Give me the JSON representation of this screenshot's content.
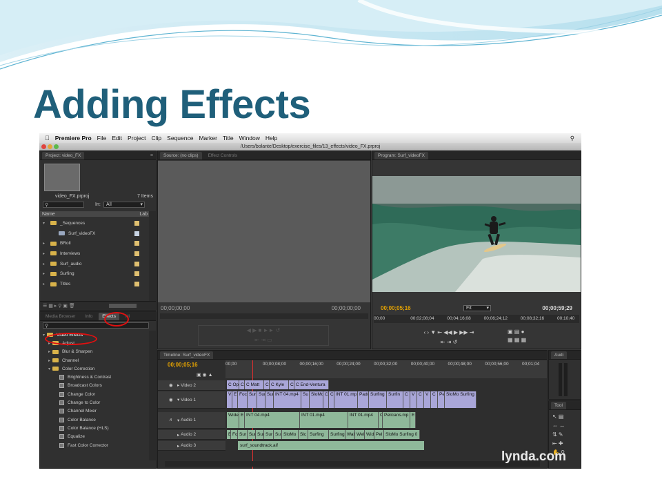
{
  "slide": {
    "title": "Adding Effects"
  },
  "menubar": {
    "apple": "",
    "app": "Premiere Pro",
    "items": [
      "File",
      "Edit",
      "Project",
      "Clip",
      "Sequence",
      "Marker",
      "Title",
      "Window",
      "Help"
    ]
  },
  "window": {
    "path": "/Users/bolante/Desktop/exercise_files/13_effects/video_FX.prproj"
  },
  "project": {
    "tab": "Project: video_FX",
    "filename": "video_FX.prproj",
    "item_count": "7 Items",
    "in_label": "In:",
    "in_value": "All",
    "col_name": "Name",
    "col_label": "Lab",
    "items": [
      {
        "name": "_Sequences",
        "indent": 0,
        "open": true
      },
      {
        "name": "Surf_videoFX",
        "indent": 1,
        "open": false
      },
      {
        "name": "BRoll",
        "indent": 0,
        "open": false
      },
      {
        "name": "Interviews",
        "indent": 0,
        "open": false
      },
      {
        "name": "Surf_audio",
        "indent": 0,
        "open": false
      },
      {
        "name": "Surfing",
        "indent": 0,
        "open": false
      },
      {
        "name": "Titles",
        "indent": 0,
        "open": false
      }
    ]
  },
  "lowerleft": {
    "tabs": [
      "Media Browser",
      "Info",
      "Effects",
      "Hi"
    ],
    "active": "Effects",
    "effects_root": "Video Effects",
    "folders": [
      "Adjust",
      "Blur & Sharpen",
      "Channel",
      "Color Correction"
    ],
    "effects": [
      "Brightness & Contrast",
      "Broadcast Colors",
      "Change Color",
      "Change to Color",
      "Channel Mixer",
      "Color Balance",
      "Color Balance (HLS)",
      "Equalize",
      "Fast Color Corrector"
    ]
  },
  "source": {
    "tabs": [
      "Source: (no clips)",
      "Effect Controls"
    ],
    "tc_left": "00;00;00;00",
    "tc_right": "00;00;00;00"
  },
  "program": {
    "tab": "Program: Surf_videoFX",
    "tc_current": "00;00;05;16",
    "fit": "Fit",
    "tc_duration": "00;00;59;29",
    "ruler": [
      "00;00",
      "00;02;08;04",
      "00;04;16;08",
      "00;06;24;12",
      "00;08;32;16",
      "00;10;40"
    ]
  },
  "timeline": {
    "tab": "Timeline: Surf_videoFX",
    "tc": "00;00;05;16",
    "ruler": [
      "00;00",
      "00;00;08;00",
      "00;00;16;00",
      "00;00;24;00",
      "00;00;32;00",
      "00;00;40;00",
      "00;00;48;00",
      "00;00;56;00",
      "00;01;04"
    ],
    "tracks": {
      "v2": "Video 2",
      "v1": "Video 1",
      "a1": "Audio 1",
      "a2": "Audio 2",
      "a3": "Audio 3"
    },
    "v2_clips": [
      "C Ope",
      "C",
      "C Matt",
      "C",
      "C Kyle",
      "C",
      "C End-Ventura"
    ],
    "v1_clips": [
      "V",
      "E",
      "Foc",
      "Sur",
      "Sur",
      "Sur",
      "INT 04.mp4",
      "Su",
      "SloMo",
      "C",
      "C",
      "INT 01.mp",
      "Padc",
      "Surfing",
      "Surfin",
      "C",
      "V",
      "C",
      "V",
      "C",
      "Pe",
      "SloMo Surfing"
    ],
    "a1_clips": [
      "Wide",
      "E",
      "INT 04.mp4",
      "INT 01.mp4",
      "INT 01.mp4",
      "C",
      "Pelicans.mp",
      "E"
    ],
    "a2_clips": [
      "E",
      "Foc",
      "Sur",
      "Sur",
      "Sur",
      "Sur",
      "Su",
      "SloMo",
      "Slc",
      "Surfing",
      "Surfing",
      "Wal",
      "Wel",
      "Wid",
      "Pel",
      "SloMo Surfing 0"
    ],
    "a3_clip": "surf_soundtrack.aif",
    "audio_panel": "Audi",
    "tools_panel": "Tool"
  },
  "watermark": "lynda.com",
  "colors": {
    "title": "#1f5f7a",
    "timecode": "#e8a500",
    "video_clip": "#a9a6d8",
    "audio_clip": "#8fb89a",
    "highlight": "#e01010"
  }
}
